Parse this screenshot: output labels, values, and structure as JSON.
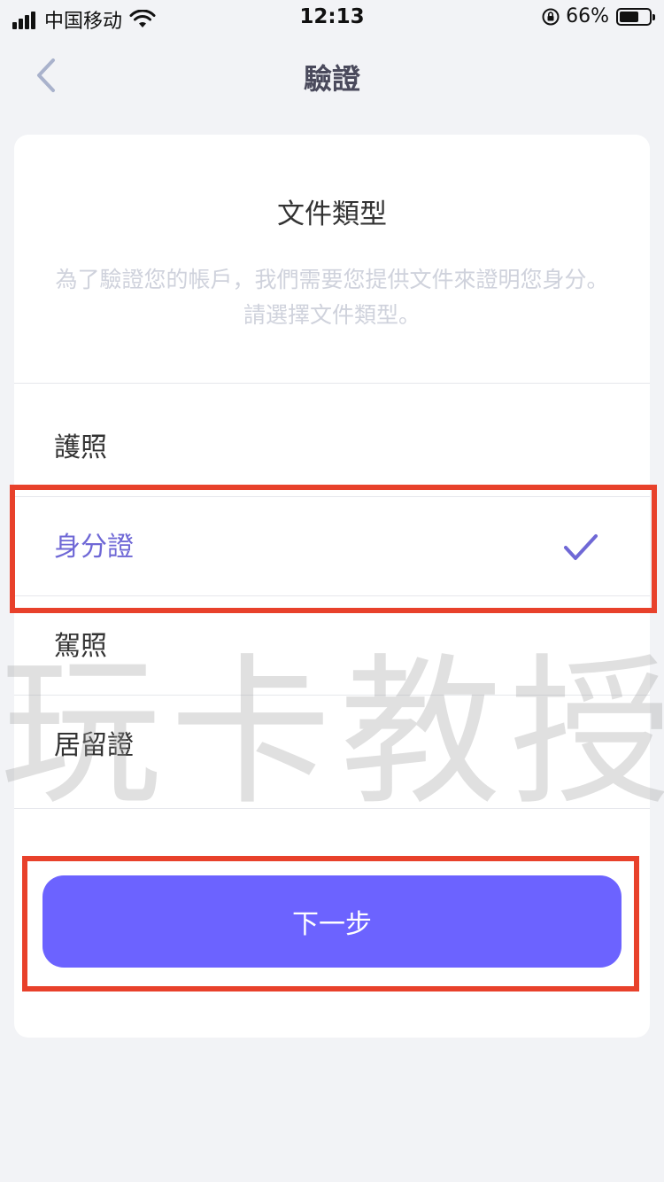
{
  "status_bar": {
    "carrier": "中国移动",
    "time": "12:13",
    "battery_percent": "66%",
    "battery_level": 0.66,
    "icons": [
      "signal-icon",
      "wifi-icon",
      "rotation-lock-icon",
      "battery-icon"
    ]
  },
  "nav": {
    "title": "驗證",
    "back_icon": "chevron-left-icon"
  },
  "card": {
    "title": "文件類型",
    "description": "為了驗證您的帳戶，我們需要您提供文件來證明您身分。請選擇文件類型。"
  },
  "options": [
    {
      "label": "護照",
      "selected": false
    },
    {
      "label": "身分證",
      "selected": true
    },
    {
      "label": "駕照",
      "selected": false
    },
    {
      "label": "居留證",
      "selected": false
    }
  ],
  "next_button": {
    "label": "下一步"
  },
  "watermark": "玩卡教授",
  "colors": {
    "accent": "#6c63ff",
    "selected_text": "#6f68d6",
    "highlight": "#e8412b",
    "background": "#f2f3f6"
  }
}
